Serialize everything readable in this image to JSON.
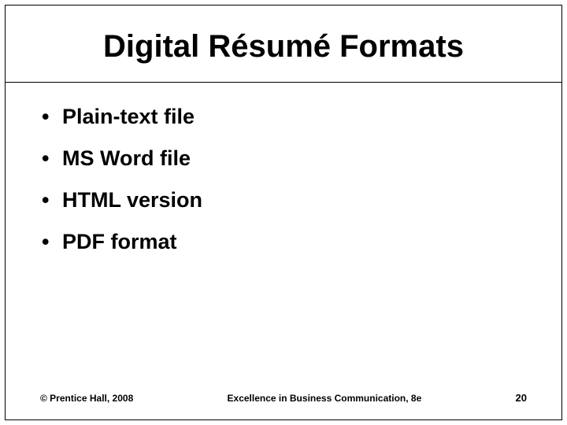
{
  "slide": {
    "title": "Digital Résumé Formats",
    "bullets": [
      "Plain-text file",
      "MS Word file",
      "HTML version",
      "PDF format"
    ],
    "footer": {
      "copyright": "© Prentice Hall, 2008",
      "book_title": "Excellence in Business Communication, 8e",
      "page_number": "20"
    }
  }
}
